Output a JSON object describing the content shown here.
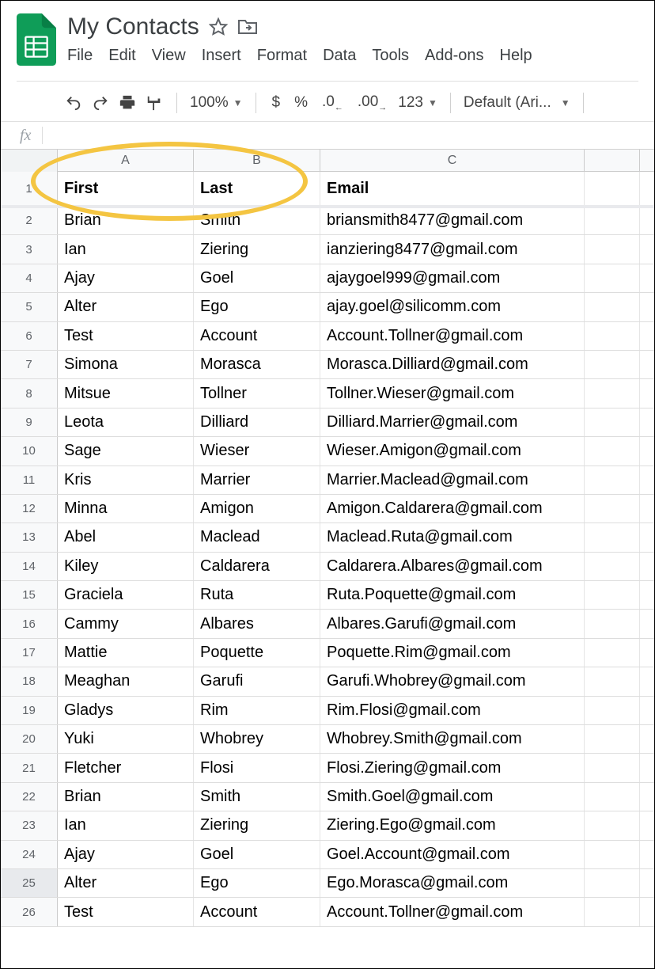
{
  "doc": {
    "title": "My Contacts"
  },
  "menu": [
    "File",
    "Edit",
    "View",
    "Insert",
    "Format",
    "Data",
    "Tools",
    "Add-ons",
    "Help"
  ],
  "toolbar": {
    "zoom": "100%",
    "currency": "$",
    "percent": "%",
    "dec_less": ".0",
    "dec_more": ".00",
    "num_format": "123",
    "font": "Default (Ari..."
  },
  "columns": [
    "A",
    "B",
    "C"
  ],
  "headers": [
    "First",
    "Last",
    "Email"
  ],
  "rows": [
    {
      "n": 1
    },
    {
      "n": 2,
      "first": "Brian",
      "last": "Smith",
      "email": "briansmith8477@gmail.com"
    },
    {
      "n": 3,
      "first": "Ian",
      "last": "Ziering",
      "email": "ianziering8477@gmail.com"
    },
    {
      "n": 4,
      "first": "Ajay",
      "last": "Goel",
      "email": "ajaygoel999@gmail.com"
    },
    {
      "n": 5,
      "first": "Alter",
      "last": "Ego",
      "email": "ajay.goel@silicomm.com"
    },
    {
      "n": 6,
      "first": "Test",
      "last": "Account",
      "email": "Account.Tollner@gmail.com"
    },
    {
      "n": 7,
      "first": "Simona",
      "last": "Morasca",
      "email": "Morasca.Dilliard@gmail.com"
    },
    {
      "n": 8,
      "first": "Mitsue",
      "last": "Tollner",
      "email": "Tollner.Wieser@gmail.com"
    },
    {
      "n": 9,
      "first": "Leota",
      "last": "Dilliard",
      "email": "Dilliard.Marrier@gmail.com"
    },
    {
      "n": 10,
      "first": "Sage",
      "last": "Wieser",
      "email": "Wieser.Amigon@gmail.com"
    },
    {
      "n": 11,
      "first": "Kris",
      "last": "Marrier",
      "email": "Marrier.Maclead@gmail.com"
    },
    {
      "n": 12,
      "first": "Minna",
      "last": "Amigon",
      "email": "Amigon.Caldarera@gmail.com"
    },
    {
      "n": 13,
      "first": "Abel",
      "last": "Maclead",
      "email": "Maclead.Ruta@gmail.com"
    },
    {
      "n": 14,
      "first": "Kiley",
      "last": "Caldarera",
      "email": "Caldarera.Albares@gmail.com"
    },
    {
      "n": 15,
      "first": "Graciela",
      "last": "Ruta",
      "email": "Ruta.Poquette@gmail.com"
    },
    {
      "n": 16,
      "first": "Cammy",
      "last": "Albares",
      "email": "Albares.Garufi@gmail.com"
    },
    {
      "n": 17,
      "first": "Mattie",
      "last": "Poquette",
      "email": "Poquette.Rim@gmail.com"
    },
    {
      "n": 18,
      "first": "Meaghan",
      "last": "Garufi",
      "email": "Garufi.Whobrey@gmail.com"
    },
    {
      "n": 19,
      "first": "Gladys",
      "last": "Rim",
      "email": "Rim.Flosi@gmail.com"
    },
    {
      "n": 20,
      "first": "Yuki",
      "last": "Whobrey",
      "email": "Whobrey.Smith@gmail.com"
    },
    {
      "n": 21,
      "first": "Fletcher",
      "last": "Flosi",
      "email": "Flosi.Ziering@gmail.com"
    },
    {
      "n": 22,
      "first": "Brian",
      "last": "Smith",
      "email": "Smith.Goel@gmail.com"
    },
    {
      "n": 23,
      "first": "Ian",
      "last": "Ziering",
      "email": "Ziering.Ego@gmail.com"
    },
    {
      "n": 24,
      "first": "Ajay",
      "last": "Goel",
      "email": "Goel.Account@gmail.com"
    },
    {
      "n": 25,
      "first": "Alter",
      "last": "Ego",
      "email": "Ego.Morasca@gmail.com"
    },
    {
      "n": 26,
      "first": "Test",
      "last": "Account",
      "email": "Account.Tollner@gmail.com"
    }
  ],
  "selected_row": 25
}
